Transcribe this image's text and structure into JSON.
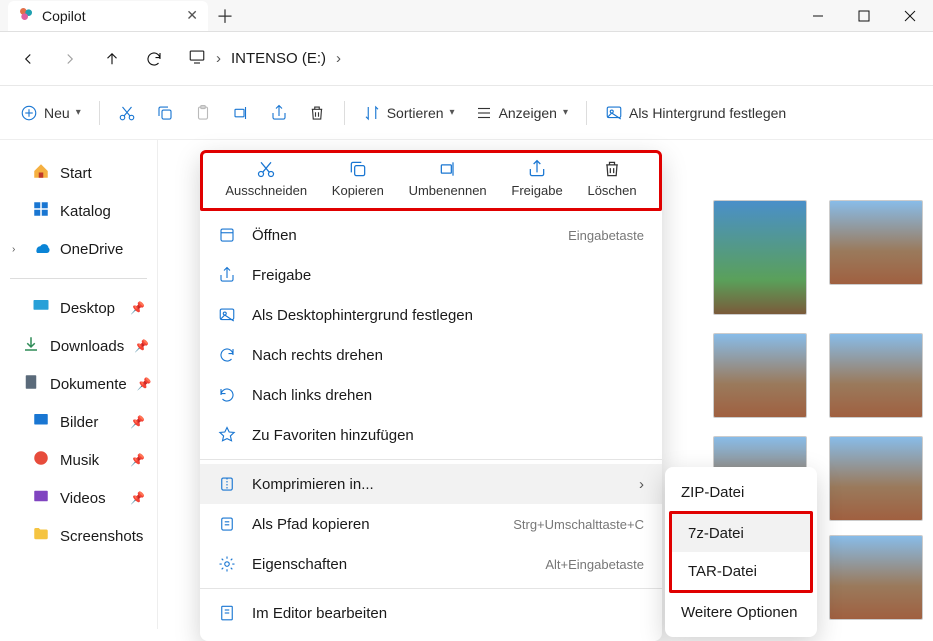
{
  "titlebar": {
    "tab_label": "Copilot"
  },
  "breadcrumb": {
    "location": "INTENSO (E:)"
  },
  "toolbar": {
    "new": "Neu",
    "sort": "Sortieren",
    "view": "Anzeigen",
    "background": "Als Hintergrund festlegen"
  },
  "sidebar": {
    "start": "Start",
    "katalog": "Katalog",
    "onedrive": "OneDrive",
    "desktop": "Desktop",
    "downloads": "Downloads",
    "dokumente": "Dokumente",
    "bilder": "Bilder",
    "musik": "Musik",
    "videos": "Videos",
    "screenshots": "Screenshots"
  },
  "context_top": {
    "cut": "Ausschneiden",
    "copy": "Kopieren",
    "rename": "Umbenennen",
    "share": "Freigabe",
    "delete": "Löschen"
  },
  "context": {
    "open": "Öffnen",
    "open_sc": "Eingabetaste",
    "share": "Freigabe",
    "set_bg": "Als Desktophintergrund festlegen",
    "rotate_r": "Nach rechts drehen",
    "rotate_l": "Nach links drehen",
    "favorite": "Zu Favoriten hinzufügen",
    "compress": "Komprimieren in...",
    "copy_path": "Als Pfad kopieren",
    "copy_path_sc": "Strg+Umschalttaste+C",
    "properties": "Eigenschaften",
    "properties_sc": "Alt+Eingabetaste",
    "edit_editor": "Im Editor bearbeiten"
  },
  "submenu": {
    "zip": "ZIP-Datei",
    "sevenz": "7z-Datei",
    "tar": "TAR-Datei",
    "more": "Weitere Optionen"
  }
}
